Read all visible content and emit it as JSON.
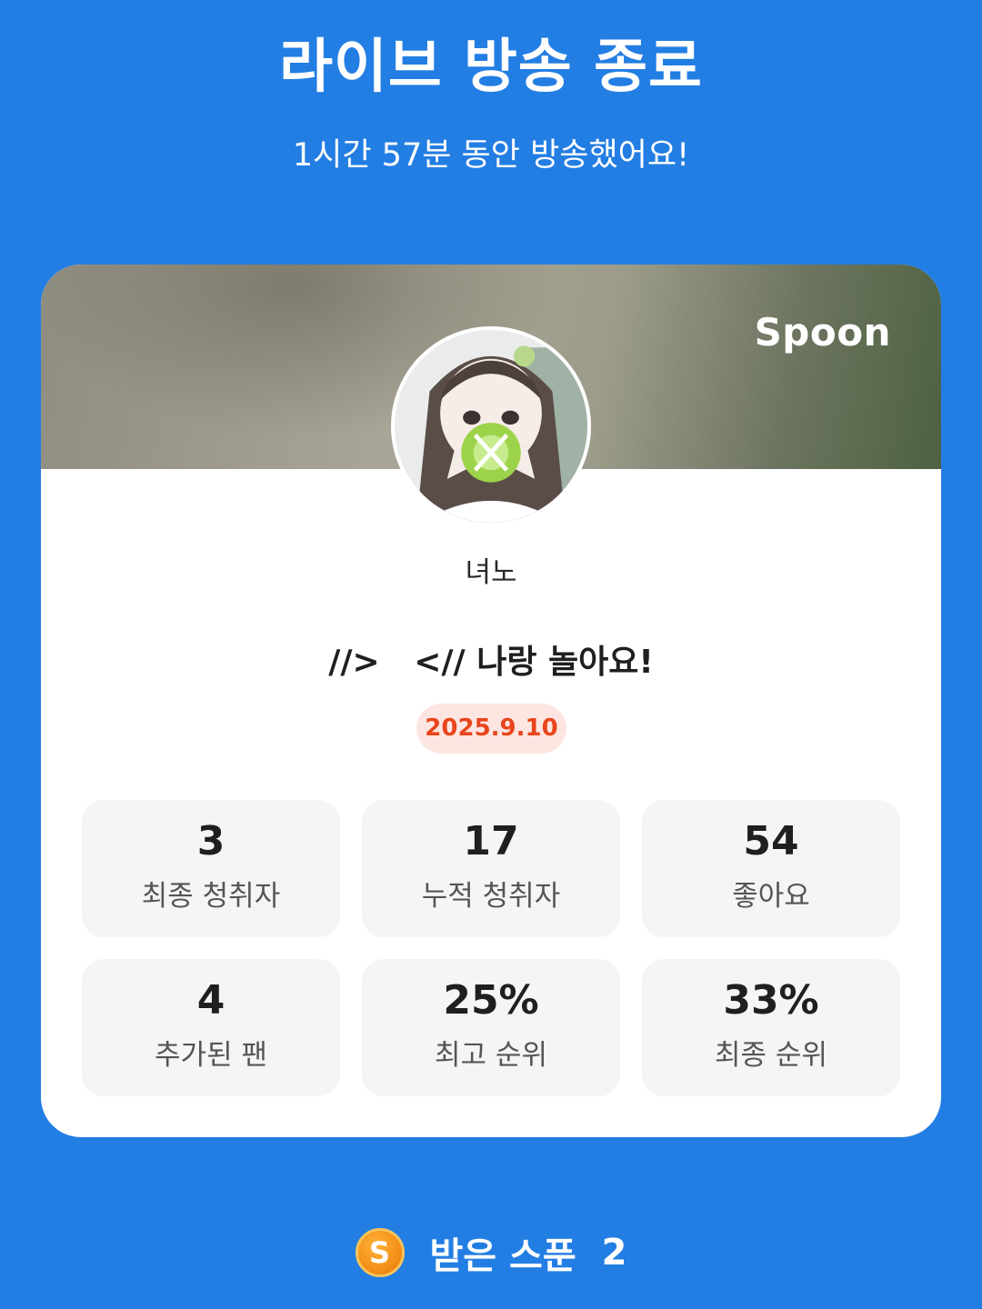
{
  "header": {
    "title": "라이브 방송 종료",
    "duration_text": "1시간 57분 동안 방송했어요!"
  },
  "card": {
    "brand": "Spoon",
    "nickname": "녀노",
    "room_title": "//>   <// 나랑 놀아요!",
    "date": "2025.9.10",
    "stats": [
      {
        "value": "3",
        "label": "최종 청취자"
      },
      {
        "value": "17",
        "label": "누적 청취자"
      },
      {
        "value": "54",
        "label": "좋아요"
      },
      {
        "value": "4",
        "label": "추가된 팬"
      },
      {
        "value": "25%",
        "label": "최고 순위"
      },
      {
        "value": "33%",
        "label": "최종 순위"
      }
    ]
  },
  "footer": {
    "coin_letter": "S",
    "received_label": "받은 스푼",
    "received_count": "2"
  },
  "icons": {
    "coin": "spoon-coin-icon",
    "avatar": "profile-avatar-image"
  },
  "colors": {
    "background": "#237ee3",
    "date_badge_bg": "#fde6e1",
    "date_badge_text": "#e8451d",
    "stat_bg": "#f5f5f5"
  }
}
